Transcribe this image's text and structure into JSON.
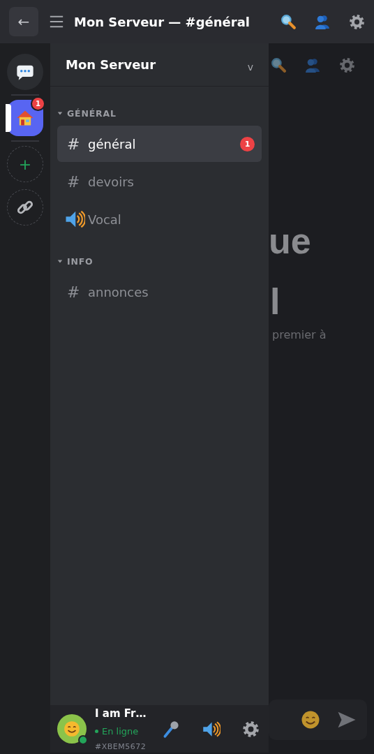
{
  "topbar": {
    "back": "←",
    "title": "Mon Serveur — #général"
  },
  "rail": {
    "items": [
      {
        "kind": "dm",
        "selected": false
      },
      {
        "kind": "server",
        "selected": true,
        "badge": "1"
      },
      {
        "kind": "add",
        "label": "+",
        "selected": false
      },
      {
        "kind": "link",
        "selected": false
      }
    ]
  },
  "panel": {
    "title": "Mon Serveur",
    "chevron": "v",
    "categories": [
      {
        "name": "GÉNÉRAL",
        "expanded": true,
        "channels": [
          {
            "kind": "text",
            "icon": "#",
            "name": "général",
            "selected": true,
            "badge": "1"
          },
          {
            "kind": "text",
            "icon": "#",
            "name": "devoirs",
            "selected": false
          },
          {
            "kind": "voice",
            "name": "Vocal",
            "selected": false
          }
        ]
      },
      {
        "name": "INFO",
        "expanded": true,
        "channels": [
          {
            "kind": "text",
            "icon": "#",
            "name": "annonces",
            "selected": false
          }
        ]
      }
    ]
  },
  "user": {
    "name": "I am Fr…",
    "online": true,
    "status": "En ligne",
    "tag": "#XBEM5672"
  },
  "chat": {
    "welcome_fragments": [
      "ue",
      "l"
    ],
    "subtitle_fragment": "premier à"
  }
}
